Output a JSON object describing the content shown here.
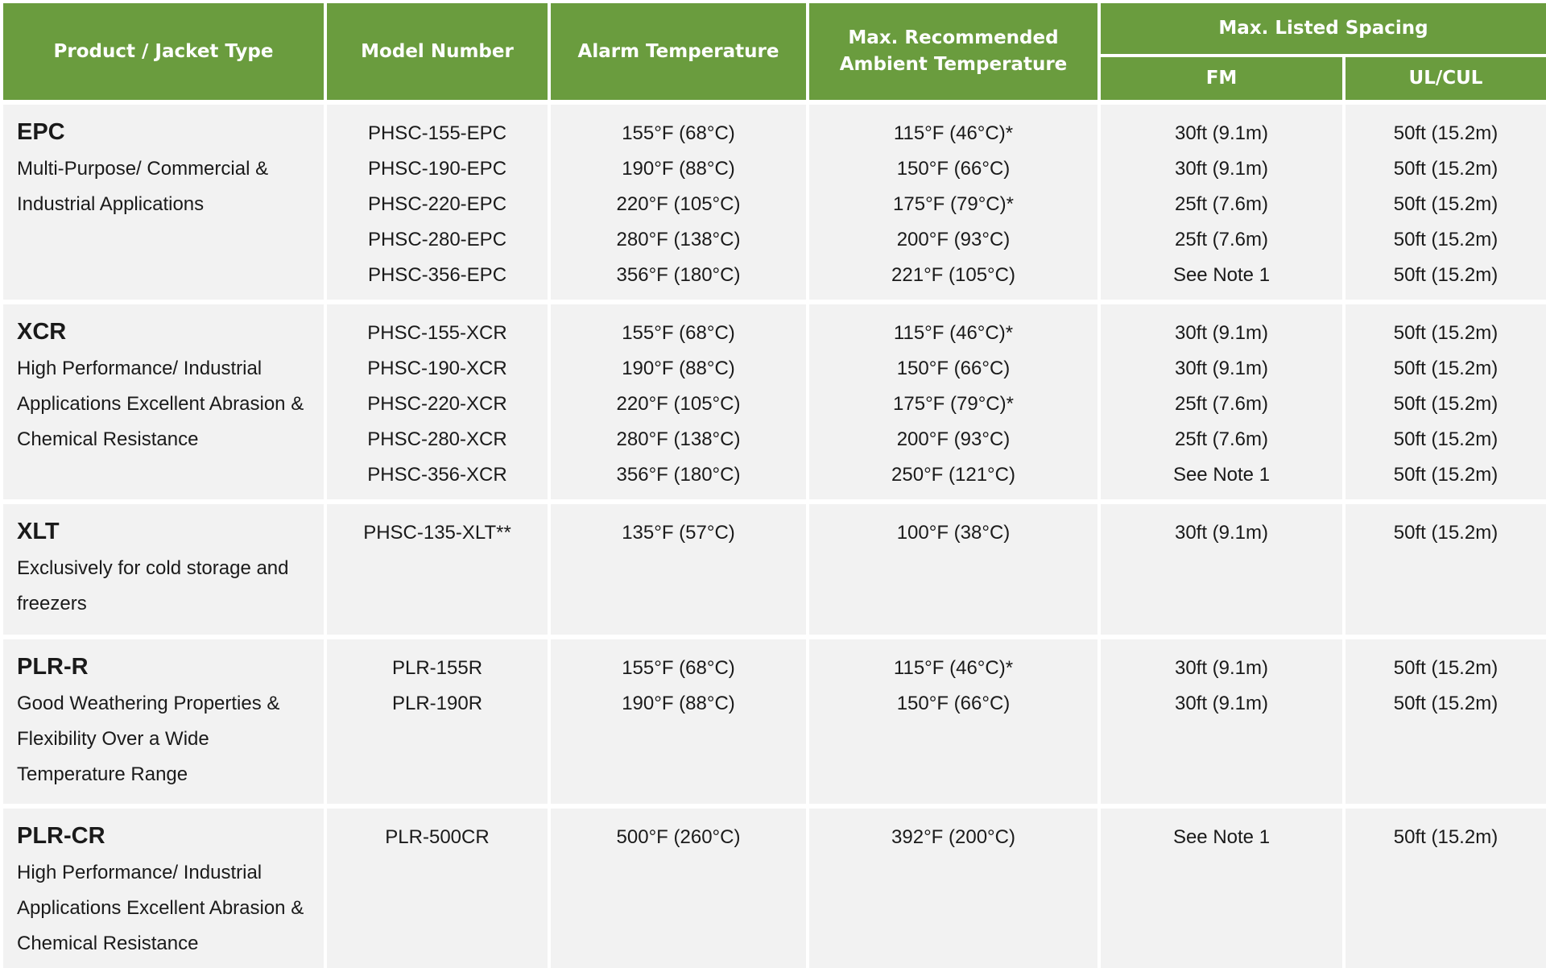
{
  "headers": {
    "product": "Product / Jacket Type",
    "model": "Model Number",
    "alarm": "Alarm Temperature",
    "ambient_line1": "Max. Recommended",
    "ambient_line2": "Ambient Temperature",
    "spacing": "Max. Listed Spacing",
    "fm": "FM",
    "ul": "UL/CUL"
  },
  "groups": [
    {
      "name": "EPC",
      "description": [
        "Multi-Purpose/ Commercial &",
        "Industrial Applications"
      ],
      "models": [
        "PHSC-155-EPC",
        "PHSC-190-EPC",
        "PHSC-220-EPC",
        "PHSC-280-EPC",
        "PHSC-356-EPC"
      ],
      "alarm": [
        "155°F (68°C)",
        "190°F (88°C)",
        "220°F (105°C)",
        "280°F (138°C)",
        "356°F (180°C)"
      ],
      "ambient": [
        "115°F (46°C)*",
        "150°F (66°C)",
        "175°F (79°C)*",
        "200°F (93°C)",
        "221°F (105°C)"
      ],
      "fm": [
        "30ft (9.1m)",
        "30ft (9.1m)",
        "25ft (7.6m)",
        "25ft (7.6m)",
        "See Note 1"
      ],
      "ul": [
        "50ft (15.2m)",
        "50ft (15.2m)",
        "50ft (15.2m)",
        "50ft (15.2m)",
        "50ft (15.2m)"
      ]
    },
    {
      "name": "XCR",
      "description": [
        "High Performance/ Industrial",
        "Applications Excellent Abrasion &",
        "Chemical Resistance"
      ],
      "models": [
        "PHSC-155-XCR",
        "PHSC-190-XCR",
        "PHSC-220-XCR",
        "PHSC-280-XCR",
        "PHSC-356-XCR"
      ],
      "alarm": [
        "155°F (68°C)",
        "190°F (88°C)",
        "220°F (105°C)",
        "280°F (138°C)",
        "356°F (180°C)"
      ],
      "ambient": [
        "115°F (46°C)*",
        "150°F (66°C)",
        "175°F (79°C)*",
        "200°F (93°C)",
        "250°F (121°C)"
      ],
      "fm": [
        "30ft (9.1m)",
        "30ft (9.1m)",
        "25ft (7.6m)",
        "25ft (7.6m)",
        "See Note 1"
      ],
      "ul": [
        "50ft (15.2m)",
        "50ft (15.2m)",
        "50ft (15.2m)",
        "50ft (15.2m)",
        "50ft (15.2m)"
      ]
    },
    {
      "name": "XLT",
      "description": [
        "Exclusively for cold storage and",
        "freezers"
      ],
      "models": [
        "PHSC-135-XLT**"
      ],
      "alarm": [
        "135°F (57°C)"
      ],
      "ambient": [
        "100°F (38°C)"
      ],
      "fm": [
        "30ft (9.1m)"
      ],
      "ul": [
        "50ft (15.2m)"
      ]
    },
    {
      "name": "PLR-R",
      "description": [
        "Good Weathering Properties &",
        "Flexibility Over a Wide",
        "Temperature Range"
      ],
      "models": [
        "PLR-155R",
        "PLR-190R"
      ],
      "alarm": [
        "155°F (68°C)",
        "190°F (88°C)"
      ],
      "ambient": [
        "115°F (46°C)*",
        "150°F (66°C)"
      ],
      "fm": [
        "30ft (9.1m)",
        "30ft (9.1m)"
      ],
      "ul": [
        "50ft (15.2m)",
        "50ft (15.2m)"
      ]
    },
    {
      "name": "PLR-CR",
      "description": [
        "High Performance/ Industrial",
        "Applications Excellent Abrasion &",
        "Chemical Resistance"
      ],
      "models": [
        "PLR-500CR"
      ],
      "alarm": [
        "500°F (260°C)"
      ],
      "ambient": [
        "392°F (200°C)"
      ],
      "fm": [
        "See Note 1"
      ],
      "ul": [
        "50ft (15.2m)"
      ]
    }
  ],
  "colors": {
    "header_bg": "#6a9c3e",
    "header_text": "#ffffff",
    "cell_bg": "#f2f2f2",
    "text": "#1a1a1a"
  }
}
